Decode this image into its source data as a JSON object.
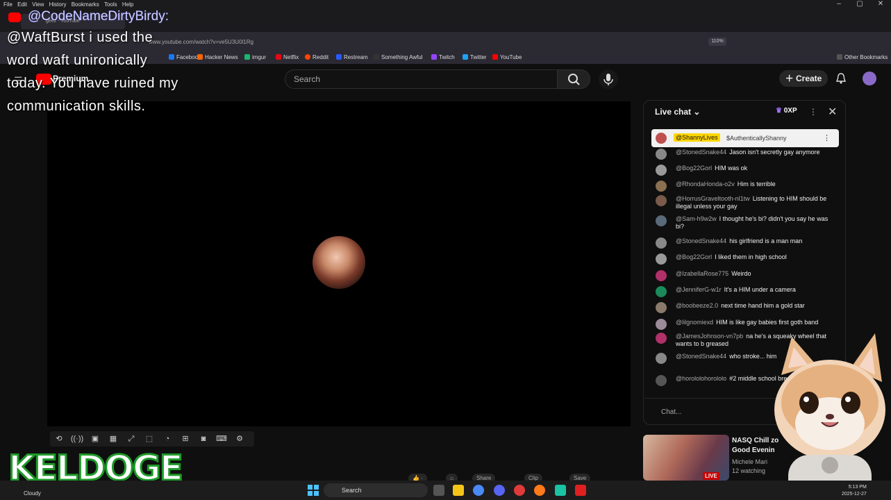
{
  "browser": {
    "menu": [
      "File",
      "Edit",
      "View",
      "History",
      "Bookmarks",
      "Tools",
      "Help"
    ],
    "tab_title": "geez - YouTube",
    "url": "www.youtube.com/watch?v=ve5U3U0l1Rg",
    "zoom": "110%",
    "bookmarks": [
      "Facebook",
      "Hacker News",
      "imgur",
      "Netflix",
      "Reddit",
      "Restream",
      "Something Awful",
      "Twitch",
      "Twitter",
      "YouTube"
    ],
    "other_bookmarks": "Other Bookmarks"
  },
  "overlay": {
    "username": "@CodeNameDirtyBirdy:",
    "message": "@WaftBurst i used the word waft unironically today. You have ruined my communication skills."
  },
  "youtube": {
    "logo_text": "Premium",
    "search_placeholder": "Search",
    "create_label": "Create"
  },
  "live_chat": {
    "title": "Live chat",
    "xp": "0XP",
    "pinned": {
      "author": "@ShannyLives",
      "text": "$AuthenticallyShanny"
    },
    "messages": [
      {
        "author": "@StonedSnake44",
        "text": "Jason isn't secretly gay anymore",
        "color": "#888888"
      },
      {
        "author": "@Bog22Gorl",
        "text": "HIM was ok",
        "color": "#999999"
      },
      {
        "author": "@RhondaHonda-o2v",
        "text": "Him is terrible",
        "color": "#8a7050"
      },
      {
        "author": "@HorrusGraveltooth-nl1tw",
        "text": "Listening to HIM should be illegal unless your gay",
        "color": "#7a5a4a"
      },
      {
        "author": "@Sam-h9w2w",
        "text": "I thought he's bi? didn't you say he was bi?",
        "color": "#5a6a7a"
      },
      {
        "author": "@StonedSnake44",
        "text": "his girlfriend is a man man",
        "color": "#888888"
      },
      {
        "author": "@Bog22Gorl",
        "text": "I liked them in high school",
        "color": "#999999"
      },
      {
        "author": "@IzabellaRose775",
        "text": "Weirdo",
        "color": "#b0306a"
      },
      {
        "author": "@JenniferG-w1r",
        "text": "It's a HIM under a camera",
        "color": "#1a8a5a"
      },
      {
        "author": "@boobeeze2.0",
        "text": "next time hand him a gold star",
        "color": "#8a7a6a"
      },
      {
        "author": "@lilgnomiexd",
        "text": "HIM is like gay babies first goth band",
        "color": "#9a8a9a"
      },
      {
        "author": "@JamesJohnson-vn7pb",
        "text": "na he's a squeaky wheel that wants to b greased",
        "color": "#b0306a"
      },
      {
        "author": "@StonedSnake44",
        "text": "who stroke... him",
        "color": "#888888"
      },
      {
        "author": "@horololohorololo",
        "text": "#2 middle school breakup ever",
        "color": "#555555"
      }
    ],
    "input_placeholder": "Chat..."
  },
  "suggestion": {
    "title": "NASQ Chill zo Good Evenin",
    "channel": "Michele Mari",
    "watching": "12 watching",
    "badge": "LIVE"
  },
  "stream_overlay": {
    "brand": "KELDOGE"
  },
  "actions": [
    "Share",
    "Clip",
    "Save"
  ],
  "taskbar": {
    "weather": "Cloudy",
    "search": "Search",
    "time": "5:13 PM",
    "date": "2025-12-27"
  },
  "colors": {
    "youtube_red": "#ff0000",
    "pinned_highlight": "#ffd600",
    "keldoge_green": "#1f9a2a"
  }
}
